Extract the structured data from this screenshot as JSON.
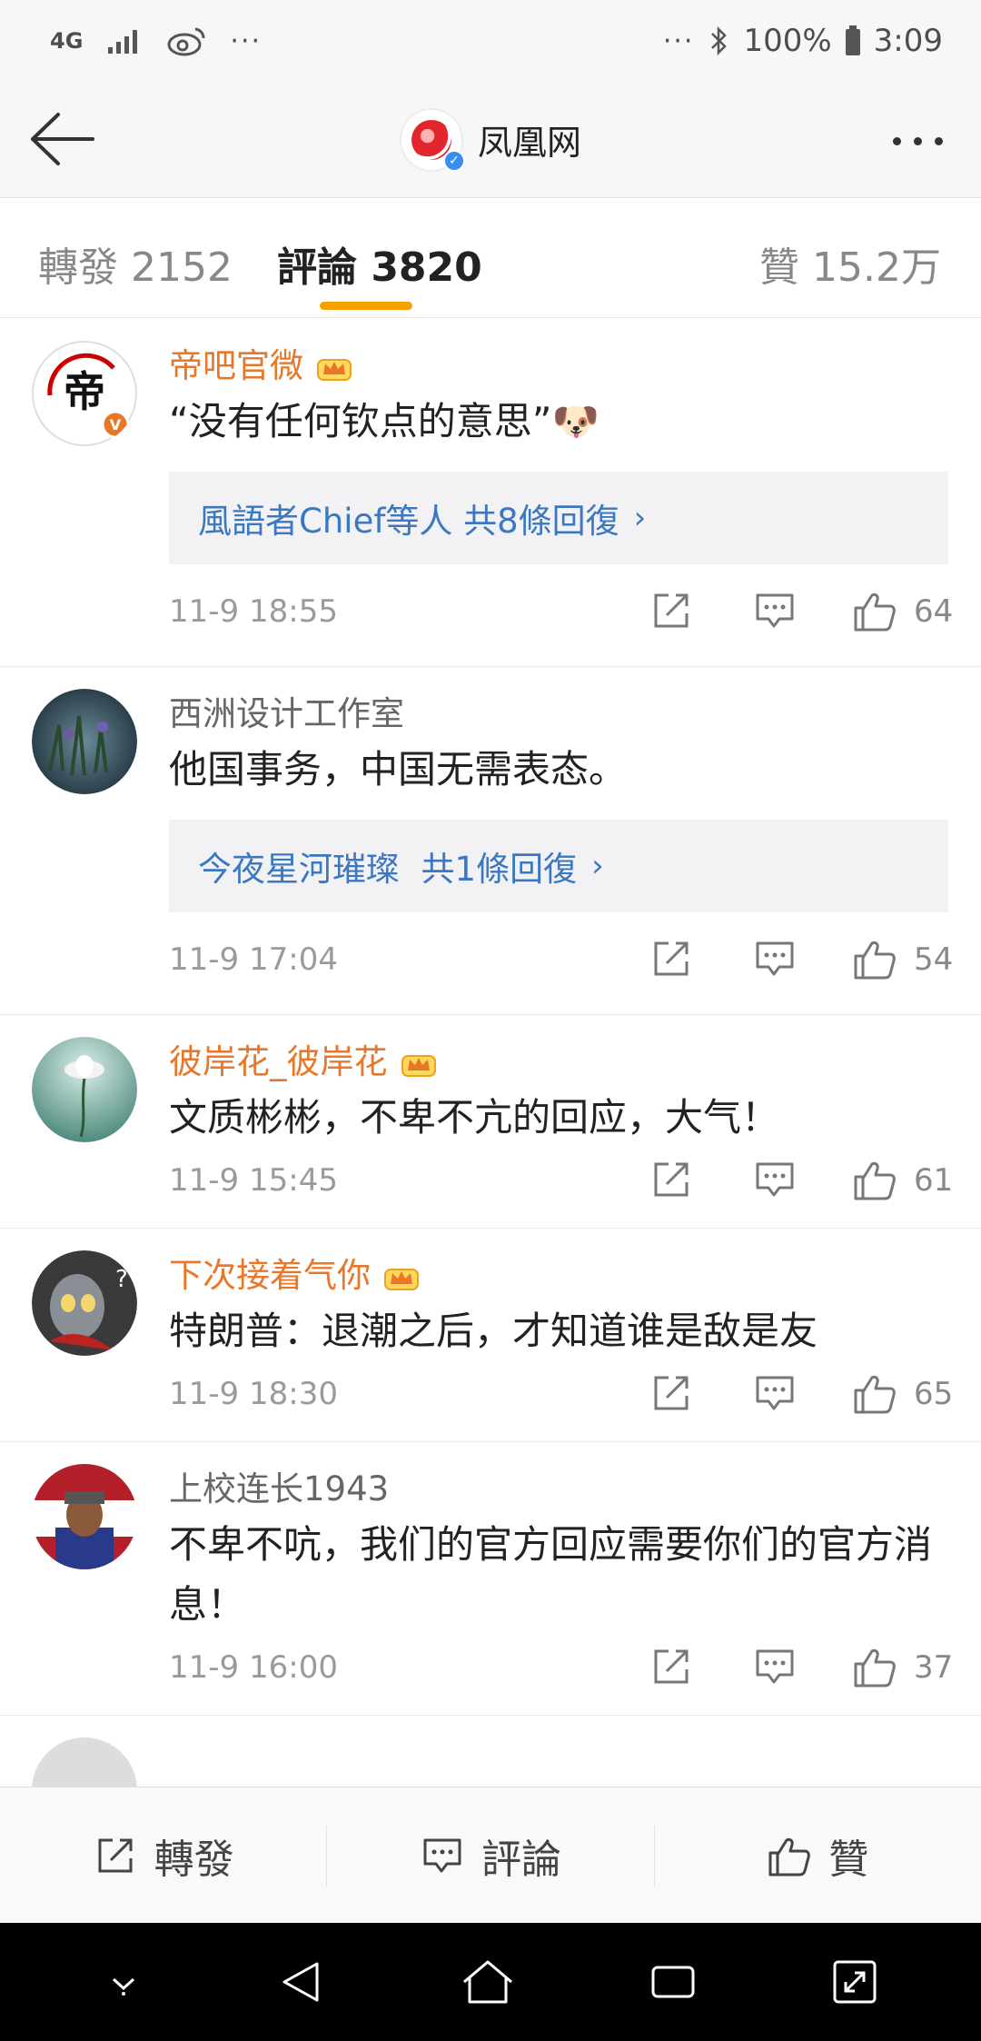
{
  "status_bar": {
    "network": "4G",
    "dots_left": "···",
    "dots_right": "···",
    "battery": "100%",
    "time": "3:09"
  },
  "header": {
    "title": "凤凰网",
    "verified": "✓"
  },
  "tabs": {
    "repost": "轉發 2152",
    "comment": "評論 3820",
    "like": "贊 15.2万"
  },
  "comments": [
    {
      "name": "帝吧官微",
      "vip": true,
      "text": "“没有任何钦点的意思”🐶",
      "reply": "風語者Chief等人 共8條回復",
      "time": "11-9 18:55",
      "likes": "64"
    },
    {
      "name": "西洲设计工作室",
      "vip": false,
      "text": "他国事务，中国无需表态。",
      "reply": "今夜星河璀璨  共1條回復",
      "time": "11-9 17:04",
      "likes": "54"
    },
    {
      "name": "彼岸花_彼岸花",
      "vip": true,
      "text": "文质彬彬，不卑不亢的回应，大气！",
      "reply": null,
      "time": "11-9 15:45",
      "likes": "61"
    },
    {
      "name": "下次接着气你",
      "vip": true,
      "text": "特朗普：退潮之后，才知道谁是敌是友",
      "reply": null,
      "time": "11-9 18:30",
      "likes": "65"
    },
    {
      "name": "上校连长1943",
      "vip": false,
      "text": "不卑不吭，我们的官方回应需要你们的官方消息！",
      "reply": null,
      "time": "11-9 16:00",
      "likes": "37"
    }
  ],
  "bottom_bar": {
    "repost": "轉發",
    "comment": "評論",
    "like": "贊"
  },
  "colors": {
    "vip_name": "#e9772a",
    "reply_link": "#3b78c1",
    "tab_accent": "#f7a100"
  }
}
